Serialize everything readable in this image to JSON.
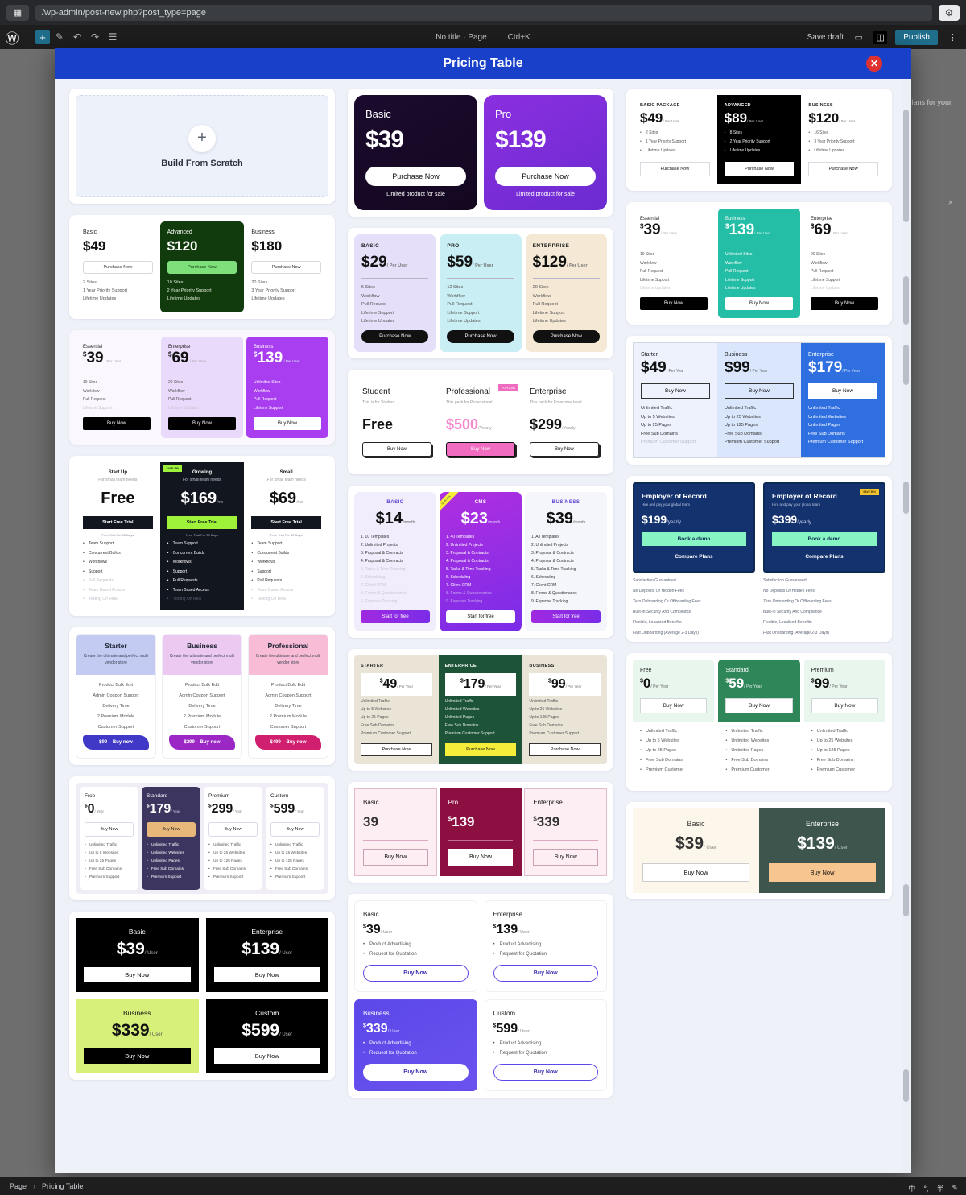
{
  "browser": {
    "apps_icon": "apps-grid-icon",
    "url": "/wp-admin/post-new.php?post_type=page",
    "settings_icon": "gear-icon"
  },
  "wp_toolbar": {
    "logo": "wordpress-logo",
    "add_label": "+",
    "tools": [
      "pencil-icon",
      "undo-icon",
      "redo-icon",
      "list-view-icon"
    ],
    "doc_title": "No title · Page",
    "shortcut": "Ctrl+K",
    "save_draft": "Save draft",
    "preview_icon": "desktop-preview-icon",
    "sidebar_icon": "settings-sidebar-icon",
    "publish_label": "Publish",
    "options_icon": "more-options-icon"
  },
  "background": {
    "hint_text": "g plans for your",
    "close_icon": "×"
  },
  "modal": {
    "title": "Pricing Table",
    "close_icon": "✕"
  },
  "scratch": {
    "icon": "plus-icon",
    "label": "Build From Scratch"
  },
  "templates": {
    "t1": {
      "plans": [
        {
          "name": "Basic",
          "price": "$49",
          "button": "Purchase Now",
          "features": [
            "2 Sites",
            "1 Year Priority Support",
            "Lifetime Updates"
          ]
        },
        {
          "name": "Advanced",
          "price": "$120",
          "button": "Purchase Now",
          "features": [
            "10 Sites",
            "2 Year Priority Support",
            "Lifetime Updates"
          ]
        },
        {
          "name": "Business",
          "price": "$180",
          "button": "Purchase Now",
          "features": [
            "20 Sites",
            "3 Year Priority Support",
            "Lifetime Updates"
          ]
        }
      ]
    },
    "t2": {
      "plans": [
        {
          "name": "Basic",
          "price": "$39",
          "button": "Purchase Now",
          "sub": "Limited product for sale"
        },
        {
          "name": "Pro",
          "price": "$139",
          "button": "Purchase Now",
          "sub": "Limited product for sale"
        }
      ]
    },
    "t3": {
      "plans": [
        {
          "name": "BASIC",
          "price": "$29",
          "per": "/ Per User",
          "button": "Purchase Now",
          "features": [
            "5 Sites",
            "Workflow",
            "Pull Request",
            "Lifetime Support",
            "Lifetime Updates"
          ]
        },
        {
          "name": "PRO",
          "price": "$59",
          "per": "/ Per User",
          "button": "Purchase Now",
          "features": [
            "12 Sites",
            "Workflow",
            "Pull Request",
            "Lifetime Support",
            "Lifetime Updates"
          ]
        },
        {
          "name": "ENTERPRISE",
          "price": "$129",
          "per": "/ Per User",
          "button": "Purchase Now",
          "features": [
            "20 Sites",
            "Workflow",
            "Pull Request",
            "Lifetime Support",
            "Lifetime Updates"
          ]
        }
      ]
    },
    "t4": {
      "badge": "POPULAR",
      "plans": [
        {
          "name": "Student",
          "desc": "This is for Student.",
          "price": "Free",
          "per": "",
          "button": "Buy Now"
        },
        {
          "name": "Professional",
          "desc": "This pack for Professional.",
          "price": "$500",
          "per": "/Yearly",
          "button": "Buy Now"
        },
        {
          "name": "Enterprise",
          "desc": "This pack for Enterprise level.",
          "price": "$299",
          "per": "/Yearly",
          "button": "Buy Now"
        }
      ]
    },
    "t5": {
      "ribbon": "SAVE 40%",
      "plans": [
        {
          "name": "BASIC",
          "price": "$14",
          "per": "/month",
          "button": "Start for free",
          "features": [
            "1. 10 Templates",
            "2. Unlimited Projects",
            "3. Proposal & Contracts",
            "4. Proposal & Contracts",
            "5. Tasks & Time Tracking",
            "6. Scheduling",
            "7. Client CRM",
            "8. Forms & Questionaries",
            "9. Expense Tracking"
          ],
          "active_count": 4
        },
        {
          "name": "CMS",
          "price": "$23",
          "per": "/month",
          "button": "Start for free",
          "features": [
            "1. 40 Templates",
            "2. Unlimited Projects",
            "3. Proposal & Contracts",
            "4. Proposal & Contracts",
            "5. Tasks & Time Tracking",
            "6. Scheduling",
            "7. Client CRM",
            "8. Forms & Questionaries",
            "9. Expense Tracking"
          ],
          "active_count": 7
        },
        {
          "name": "BUSINESS",
          "price": "$39",
          "per": "/month",
          "button": "Start for free",
          "features": [
            "1. All Templates",
            "2. Unlimited Projects",
            "3. Proposal & Contracts",
            "4. Proposal & Contracts",
            "5. Tasks & Time Tracking",
            "6. Scheduling",
            "7. Client CRM",
            "8. Forms & Questionaries",
            "9. Expense Tracking"
          ],
          "active_count": 9
        }
      ]
    },
    "t6": {
      "plans": [
        {
          "name": "STARTER",
          "cur": "$",
          "price": "49",
          "per": "/ Per Year",
          "button": "Purchase Now",
          "features": [
            "Unlimited Traffic",
            "Up to 5 Websites",
            "Up to 25 Pages",
            "Free Sub Domains",
            "Premium Customer Support"
          ]
        },
        {
          "name": "ENTERPRICE",
          "cur": "$",
          "price": "179",
          "per": "/ Per Year",
          "button": "Purchase Now",
          "features": [
            "Unlimited Traffic",
            "Unlimited Websites",
            "Unlimited Pages",
            "Free Sub Domains",
            "Premium Customer Support"
          ]
        },
        {
          "name": "BUSINESS",
          "cur": "$",
          "price": "99",
          "per": "/ Per Year",
          "button": "Purchase Now",
          "features": [
            "Unlimited Traffic",
            "Up to 25 Websites",
            "Up to 125 Pages",
            "Free Sub Domains",
            "Premium Customer Support"
          ]
        }
      ]
    },
    "t7": {
      "plans": [
        {
          "name": "Basic",
          "cur": "",
          "price": "39",
          "button": "Buy Now"
        },
        {
          "name": "Pro",
          "cur": "$",
          "price": "139",
          "button": "Buy Now"
        },
        {
          "name": "Enterprise",
          "cur": "$",
          "price": "339",
          "button": "Buy Now"
        }
      ]
    },
    "t8": {
      "plans": [
        {
          "name": "Basic",
          "price": "$39",
          "per": "/ User",
          "button": "Buy Now"
        },
        {
          "name": "Enterprise",
          "price": "$139",
          "per": "/ User",
          "button": "Buy Now"
        },
        {
          "name": "Business",
          "price": "$339",
          "per": "/ User",
          "button": "Buy Now"
        },
        {
          "name": "Custom",
          "price": "$599",
          "per": "/ User",
          "button": "Buy Now"
        }
      ]
    },
    "t9": {
      "plans": [
        {
          "name": "BASIC PACKAGE",
          "price": "$49",
          "per": "/ Per User",
          "button": "Purchase Now",
          "features": [
            "2 Sites",
            "1 Year Priority Support",
            "Lifetime Updates"
          ]
        },
        {
          "name": "ADVANCED",
          "price": "$89",
          "per": "/ Per User",
          "button": "Purchase Now",
          "features": [
            "8 Sites",
            "2 Year Priority Support",
            "Lifetime Updates"
          ]
        },
        {
          "name": "BUSINESS",
          "price": "$120",
          "per": "/ Per User",
          "button": "Purchase Now",
          "features": [
            "16 Sites",
            "3 Year Priority Support",
            "Lifetime Updates"
          ]
        }
      ]
    },
    "t10": {
      "plans": [
        {
          "name": "Essential",
          "cur": "$",
          "price": "39",
          "per": "/ Per User",
          "button": "Buy Now",
          "features": [
            "10 Sites",
            "Workflow",
            "Pull Request",
            "Lifetime Support",
            "Lifetime Updates"
          ],
          "active_count": 4
        },
        {
          "name": "Business",
          "cur": "$",
          "price": "139",
          "per": "/ Per User",
          "button": "Buy Now",
          "features": [
            "Unlimited Sites",
            "Workflow",
            "Pull Request",
            "Lifetime Support",
            "Lifetime Updates"
          ],
          "active_count": 5
        },
        {
          "name": "Enterprise",
          "cur": "$",
          "price": "69",
          "per": "/ Per User",
          "button": "Buy Now",
          "features": [
            "20 Sites",
            "Workflow",
            "Pull Request",
            "Lifetime Support",
            "Lifetime Updates"
          ],
          "active_count": 4
        }
      ]
    },
    "t11": {
      "plans": [
        {
          "name": "Starter",
          "price": "$49",
          "per": "/ Per Year",
          "button": "Buy Now",
          "features": [
            "Unlimited Traffic",
            "Up to 5 Websites",
            "Up to 25 Pages",
            "Free Sub Domains",
            "Premium Customer Support"
          ],
          "active_count": 4
        },
        {
          "name": "Business",
          "price": "$99",
          "per": "/ Per Year",
          "button": "Buy Now",
          "features": [
            "Unlimited Traffic",
            "Up to 25 Websites",
            "Up to 125 Pages",
            "Free Sub Domains",
            "Premium Customer Support"
          ],
          "active_count": 5
        },
        {
          "name": "Enterprise",
          "price": "$179",
          "per": "/ Per Year",
          "button": "Buy Now",
          "features": [
            "Unlimited Traffic",
            "Unlimited Websites",
            "Unlimited Pages",
            "Free Sub Domains",
            "Premium Customer Support"
          ],
          "active_count": 5
        }
      ]
    },
    "t12": {
      "badge": "SAVE 58%",
      "features": [
        "Satisfaction Guaranteed",
        "No Deposits Or Hidden Fees",
        "Zero Onboarding Or Offboarding Fees",
        "Built-In Security And Compliance",
        "Flexible, Localized Benefits",
        "Fast Onboarding (Average 2-3 Days)"
      ],
      "plans": [
        {
          "name": "Employer of Record",
          "desc": "Hire and pay your global team",
          "price": "$199",
          "per": "/yearly",
          "button1": "Book a demo",
          "button2": "Compare Plans"
        },
        {
          "name": "Employer of Record",
          "desc": "Hire and pay your global team",
          "price": "$399",
          "per": "/yearly",
          "button1": "Book a demo",
          "button2": "Compare Plans"
        }
      ]
    },
    "t13": {
      "plans": [
        {
          "name": "Free",
          "cur": "$",
          "price": "0",
          "per": "/ Per Year",
          "button": "Buy Now",
          "features": [
            "Unlimited Traffic",
            "Up to 5 Websites",
            "Up to 25 Pages",
            "Free Sub Domains",
            "Premium Customer"
          ]
        },
        {
          "name": "Standard",
          "cur": "$",
          "price": "59",
          "per": "/ Per Year",
          "button": "Buy Now",
          "features": [
            "Unlimited Traffic",
            "Unlimited Websites",
            "Unlimited Pages",
            "Free Sub Domains",
            "Premium Customer"
          ]
        },
        {
          "name": "Premium",
          "cur": "$",
          "price": "99",
          "per": "/ Per Year",
          "button": "Buy Now",
          "features": [
            "Unlimited Traffic",
            "Up to 25 Websites",
            "Up to 125 Pages",
            "Free Sub Domains",
            "Premium Customer"
          ]
        }
      ]
    },
    "t14": {
      "plans": [
        {
          "name": "Basic",
          "price": "$39",
          "per": "/ User",
          "button": "Buy Now"
        },
        {
          "name": "Enterprise",
          "price": "$139",
          "per": "/ User",
          "button": "Buy Now"
        }
      ]
    },
    "t15": {
      "ribbon": "SAVE 40%",
      "plans": [
        {
          "name": "Start Up",
          "desc": "For small team needs",
          "price": "Free",
          "per": "",
          "button": "Start Free Trial",
          "note": "Free Trial For 30 Days",
          "features": [
            "Team Support",
            "Concurrent Builds",
            "Workflows",
            "Support",
            "Pull Requests",
            "Team Based Access",
            "Testing On Real"
          ],
          "active_count": 4
        },
        {
          "name": "Growing",
          "desc": "For small team needs",
          "price": "$169",
          "per": "/mo",
          "button": "Start Free Trial",
          "note": "Free Trial For 30 Days",
          "features": [
            "Team Support",
            "Concurrent Builds",
            "Workflows",
            "Support",
            "Pull Requests",
            "Team Based Access",
            "Testing On Real"
          ],
          "active_count": 6
        },
        {
          "name": "Small",
          "desc": "For small team needs",
          "price": "$69",
          "per": "/mo",
          "button": "Start Free Trial",
          "note": "Free Trial For 30 Days",
          "features": [
            "Team Support",
            "Concurrent Builds",
            "Workflows",
            "Support",
            "Pull Requests",
            "Team Based Access",
            "Testing On Real"
          ],
          "active_count": 5
        }
      ]
    },
    "t16": {
      "features": [
        "Product Bulk Edit",
        "Admin Coupon Support",
        "Delivery Time",
        "2 Premium Module",
        "Customer Support"
      ],
      "plans": [
        {
          "name": "Starter",
          "desc": "Create the ultimate and perfect multi vendor store",
          "button": "$99 – Buy now"
        },
        {
          "name": "Business",
          "desc": "Create the ultimate and perfect multi vendor store",
          "button": "$299 – Buy now"
        },
        {
          "name": "Professional",
          "desc": "Create the ultimate and perfect multi vendor store",
          "button": "$499 – Buy now"
        }
      ]
    },
    "t17": {
      "plans": [
        {
          "name": "Free",
          "cur": "$",
          "price": "0",
          "per": "/ Year",
          "button": "Buy Now",
          "features": [
            "Unlimited Traffic",
            "Up to 5 Websites",
            "Up to 25 Pages",
            "Free Sub Domains",
            "Premium Support"
          ]
        },
        {
          "name": "Standard",
          "cur": "$",
          "price": "179",
          "per": "/ Year",
          "button": "Buy Now",
          "features": [
            "Unlimited Traffic",
            "Unlimited Websites",
            "Unlimited Pages",
            "Free Sub Domains",
            "Premium Support"
          ]
        },
        {
          "name": "Premium",
          "cur": "$",
          "price": "299",
          "per": "/ Year",
          "button": "Buy Now",
          "features": [
            "Unlimited Traffic",
            "Up to 25 Websites",
            "Up to 125 Pages",
            "Free Sub Domains",
            "Premium Support"
          ]
        },
        {
          "name": "Custom",
          "cur": "$",
          "price": "599",
          "per": "/ Year",
          "button": "Buy Now",
          "features": [
            "Unlimited Traffic",
            "Up to 25 Websites",
            "Up to 125 Pages",
            "Free Sub Domains",
            "Premium Support"
          ]
        }
      ]
    },
    "t18": {
      "features": [
        "Product Advertising",
        "Request for Quotation"
      ],
      "plans": [
        {
          "name": "Basic",
          "cur": "$",
          "price": "39",
          "per": "/ User",
          "button": "Buy Now"
        },
        {
          "name": "Enterprise",
          "cur": "$",
          "price": "139",
          "per": "/ User",
          "button": "Buy Now"
        },
        {
          "name": "Business",
          "cur": "$",
          "price": "339",
          "per": "/ User",
          "button": "Buy Now"
        },
        {
          "name": "Custom",
          "cur": "$",
          "price": "599",
          "per": "/ User",
          "button": "Buy Now"
        }
      ]
    }
  },
  "status_bar": {
    "page": "Page",
    "sep": "›",
    "current": "Pricing Table"
  },
  "ime": {
    "lang": "中",
    "punct": "°,",
    "mode": "半",
    "tray": "✎"
  },
  "colors": {
    "modal_header": "#1840c8",
    "close_badge": "#e03131",
    "publish": "#1f6e8c",
    "canvas": "#eef1f8"
  }
}
